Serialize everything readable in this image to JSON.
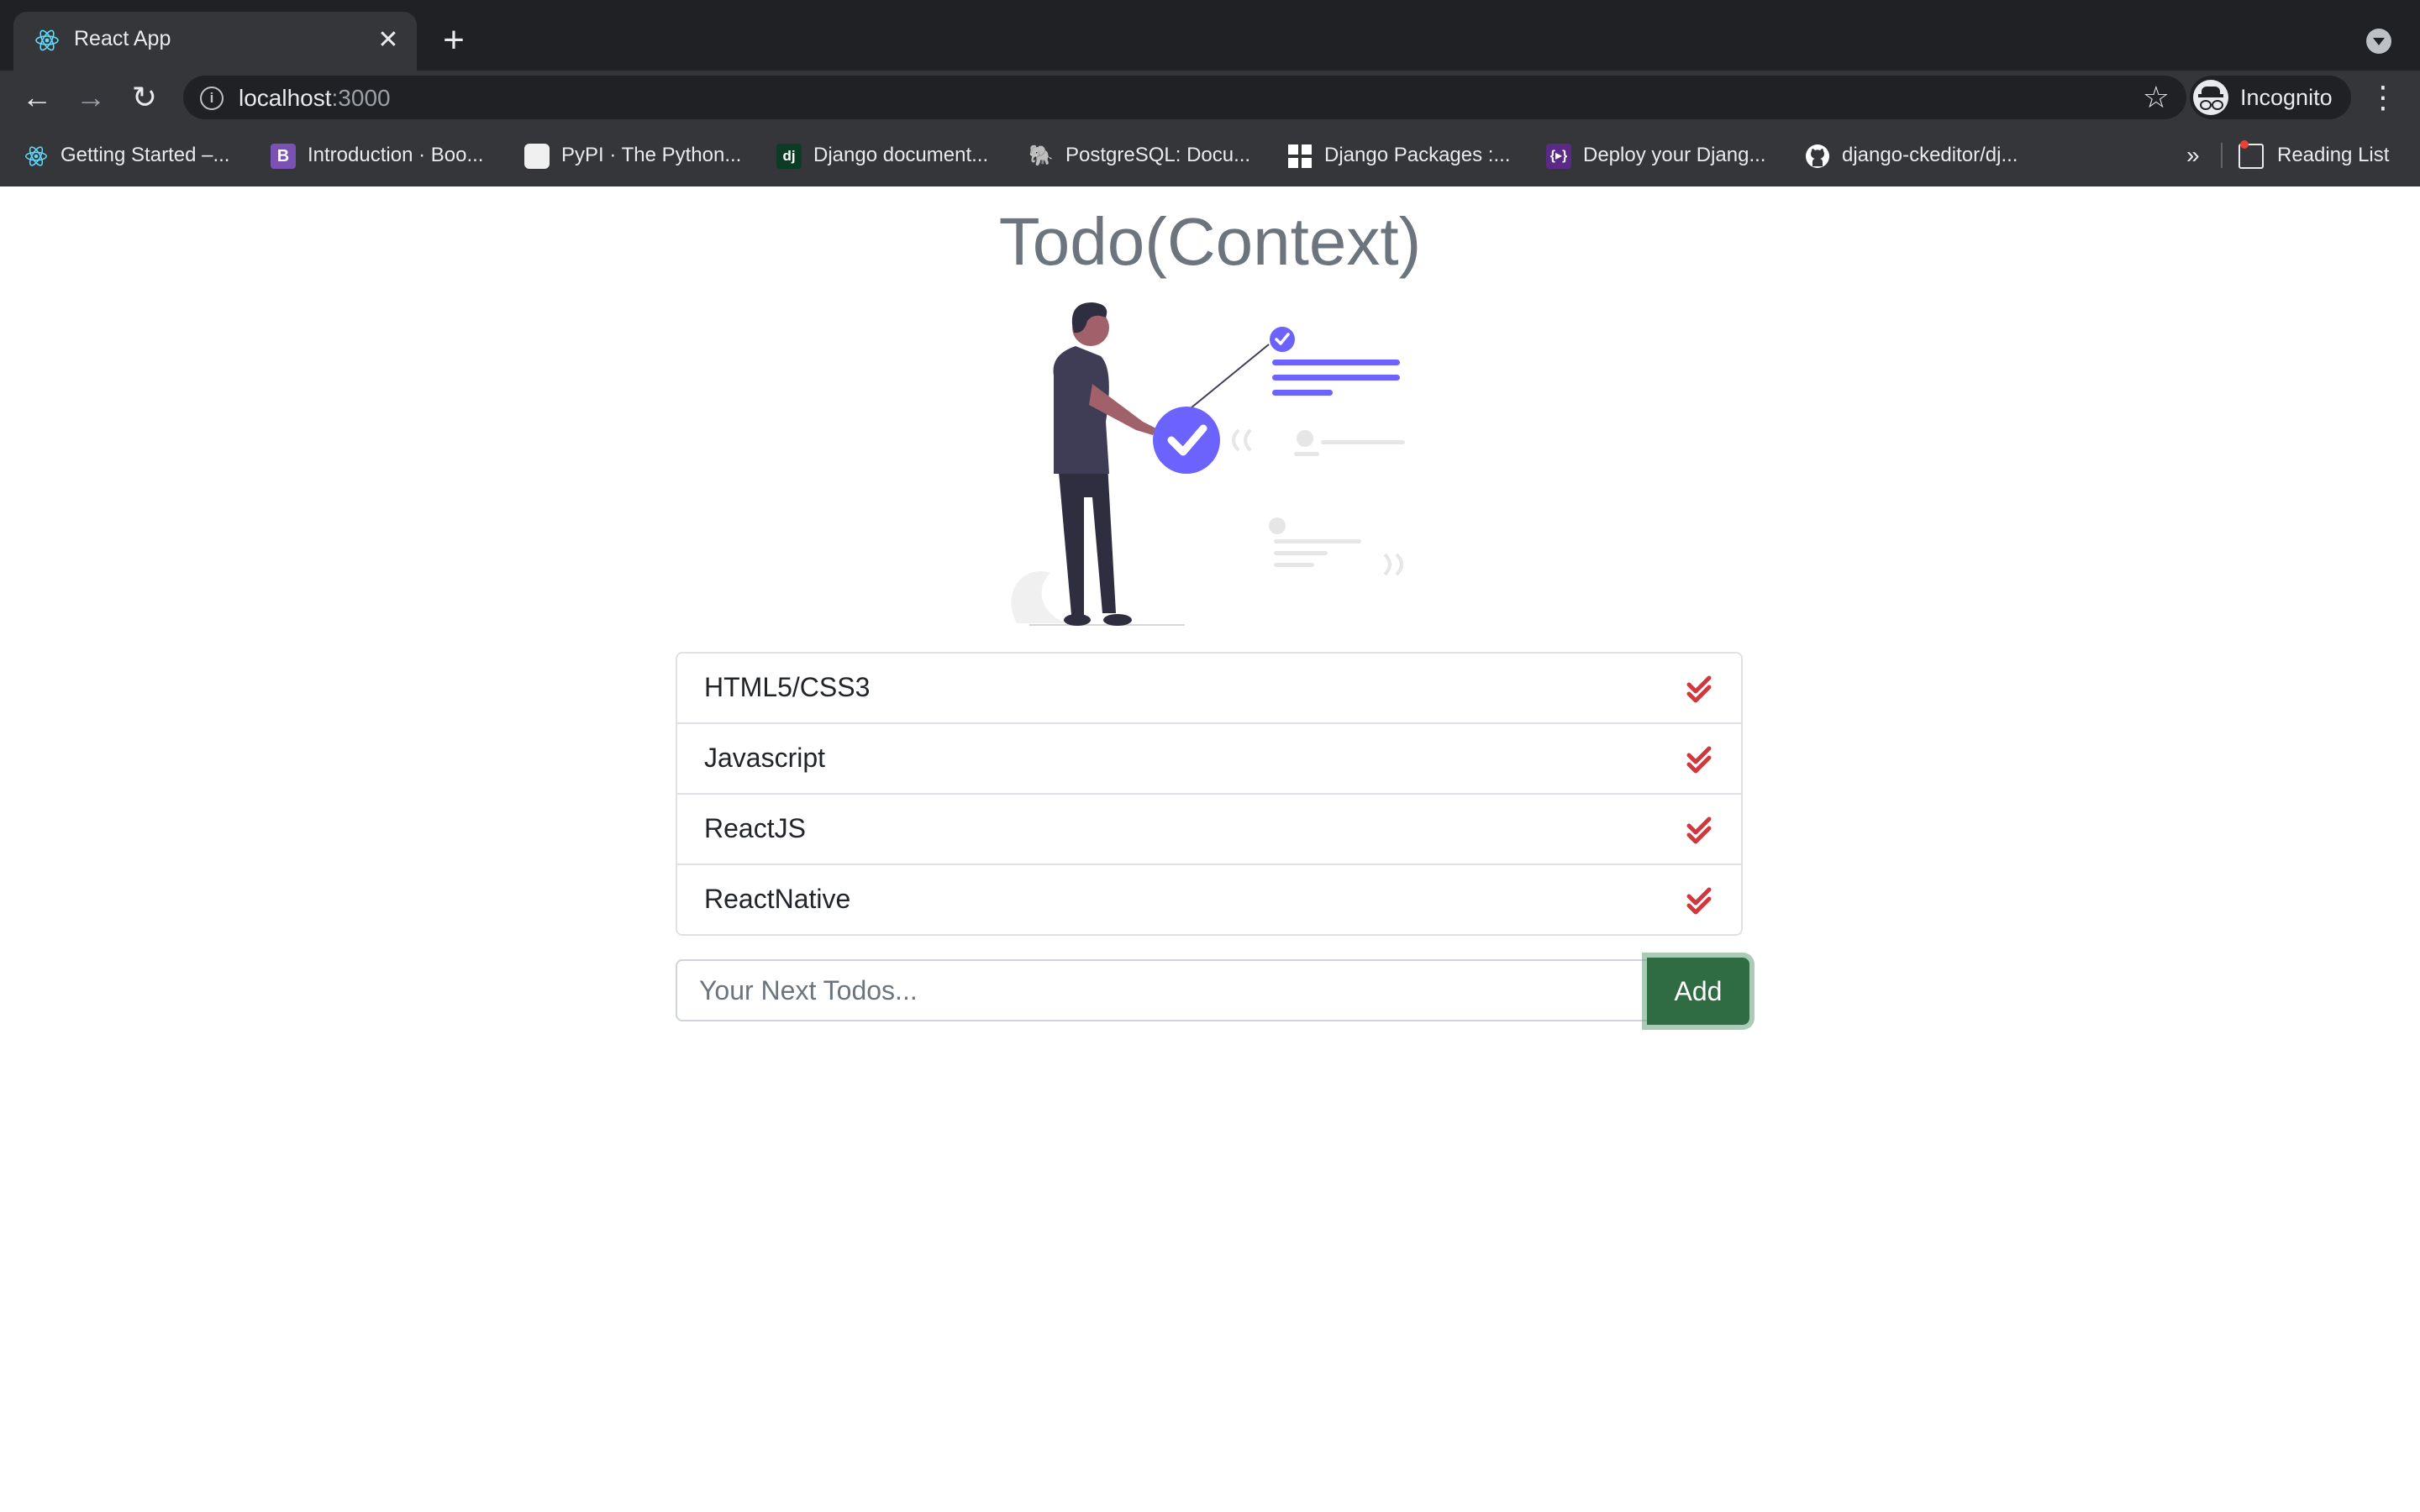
{
  "browser": {
    "tab": {
      "title": "React App"
    },
    "url": {
      "host": "localhost",
      "port": ":3000"
    },
    "profile_label": "Incognito",
    "bookmarks": [
      {
        "label": "Getting Started –..."
      },
      {
        "label": "Introduction · Boo..."
      },
      {
        "label": "PyPI · The Python..."
      },
      {
        "label": "Django document..."
      },
      {
        "label": "PostgreSQL: Docu..."
      },
      {
        "label": "Django Packages :..."
      },
      {
        "label": "Deploy your Djang..."
      },
      {
        "label": "django-ckeditor/dj..."
      }
    ],
    "bookmarks_overflow": "»",
    "reading_list_label": "Reading List"
  },
  "page": {
    "title": "Todo(Context)",
    "todos": [
      {
        "text": "HTML5/CSS3"
      },
      {
        "text": "Javascript"
      },
      {
        "text": "ReactJS"
      },
      {
        "text": "ReactNative"
      }
    ],
    "input": {
      "placeholder": "Your Next Todos...",
      "value": ""
    },
    "add_button_label": "Add"
  },
  "colors": {
    "accent_purple": "#6c63ff",
    "check_red": "#d1383d",
    "add_button_green": "#2f6b43",
    "title_gray": "#6c757d"
  }
}
